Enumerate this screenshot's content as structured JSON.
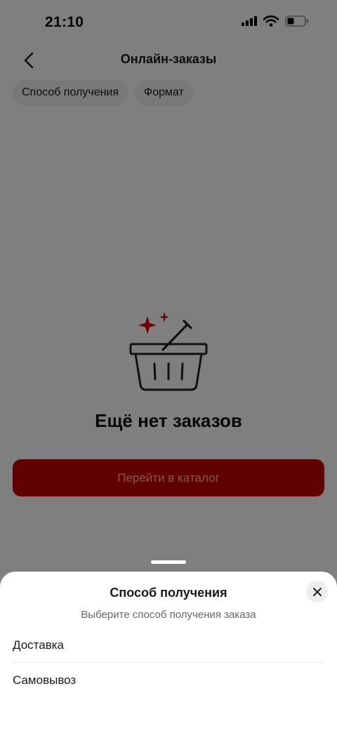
{
  "status_bar": {
    "time": "21:10"
  },
  "nav": {
    "title": "Онлайн-заказы"
  },
  "filters": [
    {
      "label": "Способ получения"
    },
    {
      "label": "Формат"
    }
  ],
  "empty_state": {
    "icon": "basket-icon",
    "title": "Ещё нет заказов",
    "button_label": "Перейти в каталог"
  },
  "sheet": {
    "title": "Способ получения",
    "subtitle": "Выберите способ получения заказа",
    "options": [
      {
        "label": "Доставка"
      },
      {
        "label": "Самовывоз"
      }
    ]
  },
  "colors": {
    "accent": "#c30000",
    "overlay": "rgba(0,0,0,0.5)"
  }
}
